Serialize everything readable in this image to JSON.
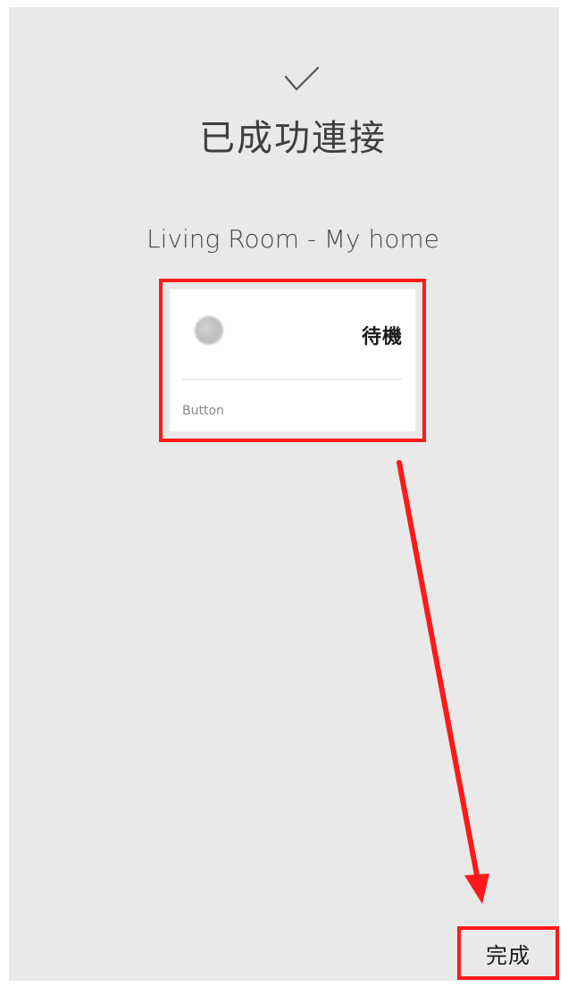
{
  "header": {
    "check_icon": "checkmark-icon",
    "title": "已成功連接"
  },
  "room": {
    "label": "Living Room - My home"
  },
  "device_card": {
    "icon": "device-circle-icon",
    "status": "待機",
    "type": "Button"
  },
  "footer": {
    "done_label": "完成"
  },
  "colors": {
    "highlight": "#ff1a1a",
    "background": "#e9e9e9",
    "card": "#ffffff"
  }
}
